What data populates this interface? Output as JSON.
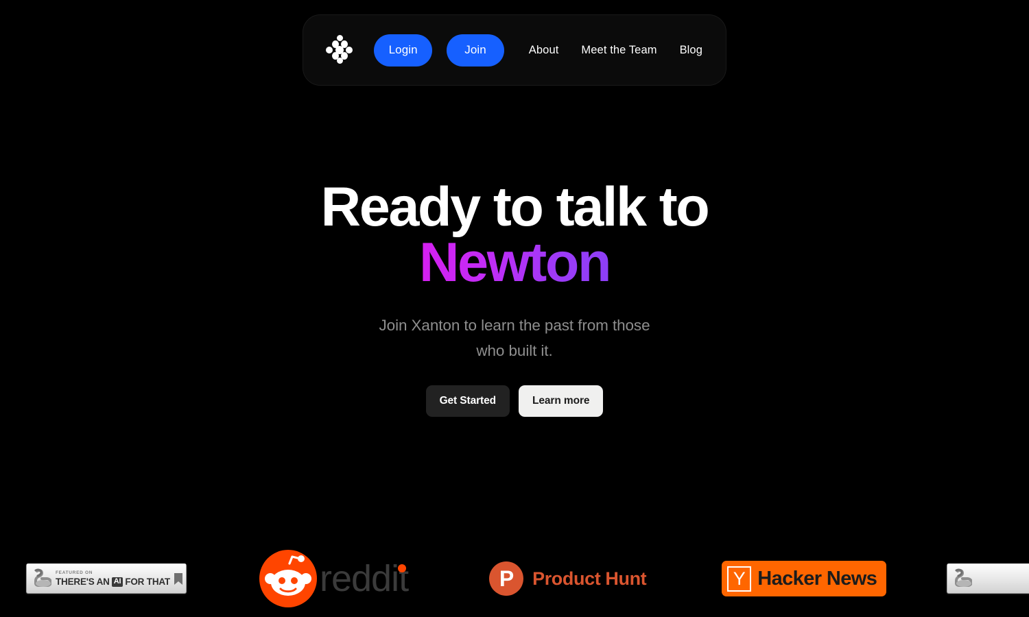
{
  "nav": {
    "logo_icon": "xanton-dot-cluster-logo",
    "login_label": "Login",
    "join_label": "Join",
    "links": [
      {
        "label": "About"
      },
      {
        "label": "Meet the Team"
      },
      {
        "label": "Blog"
      }
    ],
    "accent_color": "#1660ff",
    "bar_background": "#0b0b0b"
  },
  "hero": {
    "title_line1": "Ready to talk to",
    "title_accent": "Newton",
    "subtitle": "Join Xanton to learn the past from those who built it.",
    "primary_cta": "Get Started",
    "secondary_cta": "Learn more",
    "accent_gradient_start": "#d61ff0",
    "accent_gradient_end": "#8c3ff7",
    "title_color": "#ffffff",
    "subtitle_color": "#8e8e8e"
  },
  "marquee": {
    "taaft": {
      "featured_label": "FEATURED ON",
      "name_prefix": "THERE'S AN",
      "chip": "AI",
      "name_suffix": "FOR THAT",
      "arm_icon": "flexed-arm-icon",
      "bookmark_icon": "bookmark-icon"
    },
    "reddit": {
      "wordmark": "reddit",
      "icon": "reddit-snoo-icon",
      "color": "#ff4500"
    },
    "product_hunt": {
      "wordmark": "Product Hunt",
      "icon_letter": "P",
      "color": "#da552f"
    },
    "hacker_news": {
      "wordmark": "Hacker News",
      "icon_letter": "Y",
      "color": "#ff6600"
    },
    "taaft_repeat": {
      "arm_icon": "flexed-arm-icon"
    }
  }
}
